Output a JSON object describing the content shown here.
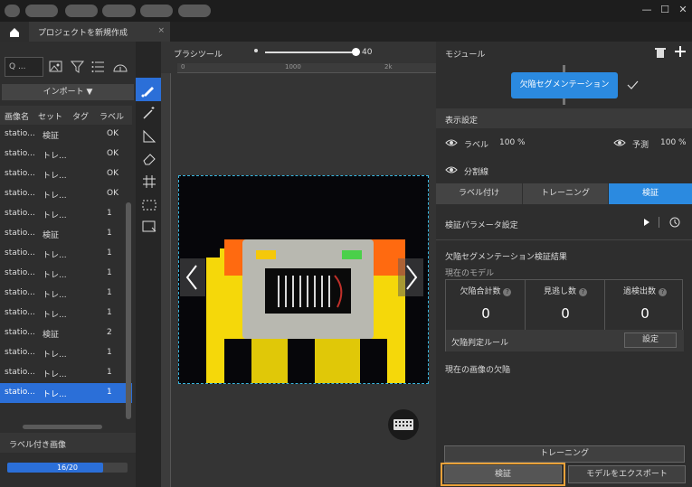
{
  "window": {
    "minimize": "—",
    "maximize": "☐",
    "close": "✕"
  },
  "tab": {
    "title": "プロジェクトを新規作成",
    "close": "×"
  },
  "left": {
    "search_placeholder": "Q ...",
    "import_label": "インポート",
    "columns": [
      "画像名",
      "セット",
      "タグ",
      "ラベル"
    ],
    "rows": [
      [
        "statio...",
        "検証",
        "",
        "OK"
      ],
      [
        "statio...",
        "トレ...",
        "",
        "OK"
      ],
      [
        "statio...",
        "トレ...",
        "",
        "OK"
      ],
      [
        "statio...",
        "トレ...",
        "",
        "OK"
      ],
      [
        "statio...",
        "トレ...",
        "",
        "1"
      ],
      [
        "statio...",
        "検証",
        "",
        "1"
      ],
      [
        "statio...",
        "トレ...",
        "",
        "1"
      ],
      [
        "statio...",
        "トレ...",
        "",
        "1"
      ],
      [
        "statio...",
        "トレ...",
        "",
        "1"
      ],
      [
        "statio...",
        "トレ...",
        "",
        "1"
      ],
      [
        "statio...",
        "検証",
        "",
        "2"
      ],
      [
        "statio...",
        "トレ...",
        "",
        "1"
      ],
      [
        "statio...",
        "トレ...",
        "",
        "1"
      ],
      [
        "statio...",
        "トレ...",
        "",
        "1"
      ]
    ],
    "labeled_title": "ラベル付き画像",
    "progress_text": "16/20",
    "progress_value": 0.8
  },
  "canvas": {
    "brush_label": "ブラシツール",
    "brush_size": "40",
    "ruler": [
      "0",
      "1000",
      "2k"
    ]
  },
  "right": {
    "module_title": "モジュール",
    "module_name": "欠陥セグメンテーション",
    "display_settings": "表示設定",
    "label_text": "ラベル",
    "label_pct": "100 %",
    "predict_text": "予測",
    "predict_pct": "100 %",
    "split_line": "分割線",
    "tabs": [
      "ラベル付け",
      "トレーニング",
      "検証"
    ],
    "param_settings": "検証パラメータ設定",
    "results_title": "欠陥セグメンテーション検証結果",
    "current_model": "現在のモデル",
    "stats": [
      {
        "label": "欠陥合計数",
        "value": "0"
      },
      {
        "label": "見逃し数",
        "value": "0"
      },
      {
        "label": "過検出数",
        "value": "0"
      }
    ],
    "rule_label": "欠陥判定ルール",
    "settings_btn": "設定",
    "current_image_defects": "現在の画像の欠陥",
    "train_btn": "トレーニング",
    "verify_btn": "検証",
    "export_btn": "モデルをエクスポート"
  },
  "colors": {
    "accent": "#2b6fd8",
    "highlight": "#e8a13a"
  }
}
